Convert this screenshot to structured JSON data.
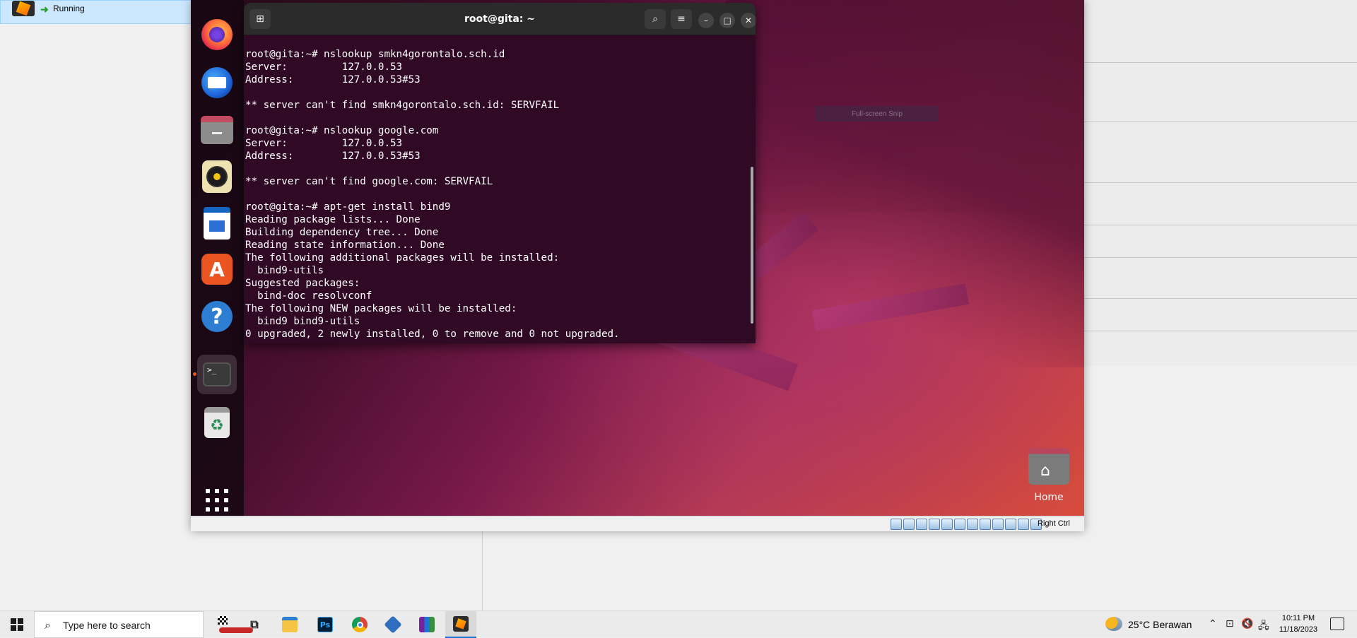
{
  "vbox_manager": {
    "vm_status": "Running"
  },
  "terminal": {
    "title": "root@gita: ~",
    "lines": [
      "root@gita:~# nslookup smkn4gorontalo.sch.id",
      "Server:         127.0.0.53",
      "Address:        127.0.0.53#53",
      "",
      "** server can't find smkn4gorontalo.sch.id: SERVFAIL",
      "",
      "root@gita:~# nslookup google.com",
      "Server:         127.0.0.53",
      "Address:        127.0.0.53#53",
      "",
      "** server can't find google.com: SERVFAIL",
      "",
      "root@gita:~# apt-get install bind9",
      "Reading package lists... Done",
      "Building dependency tree... Done",
      "Reading state information... Done",
      "The following additional packages will be installed:",
      "  bind9-utils",
      "Suggested packages:",
      "  bind-doc resolvconf",
      "The following NEW packages will be installed:",
      "  bind9 bind9-utils",
      "0 upgraded, 2 newly installed, 0 to remove and 0 not upgraded."
    ]
  },
  "snip_overlay": "Full-screen Snip",
  "desktop": {
    "home_label": "Home"
  },
  "dock": {
    "icons": [
      "firefox-icon",
      "thunderbird-icon",
      "files-icon",
      "rhythmbox-icon",
      "writer-icon",
      "app-center-icon",
      "help-icon",
      "terminal-icon",
      "trash-icon",
      "show-apps-icon"
    ],
    "terminal_glyph": ">_",
    "help_glyph": "?",
    "app_center_glyph": "A",
    "trash_glyph": "♻"
  },
  "vm_statusbar": {
    "host_key": "Right Ctrl"
  },
  "taskbar": {
    "search_placeholder": "Type here to search",
    "weather": "25°C  Berawan",
    "time": "10:11 PM",
    "date": "11/18/2023",
    "ps_label": "Ps"
  },
  "colors": {
    "terminal_bg": "#300a24",
    "ubuntu_accent": "#e95420",
    "selection_blue": "#cce8ff"
  }
}
